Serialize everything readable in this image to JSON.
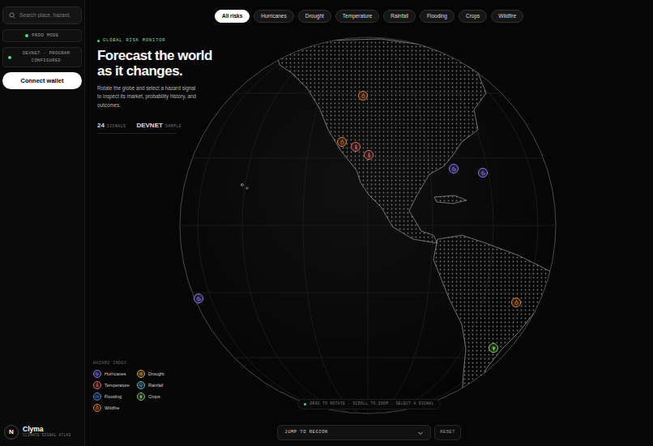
{
  "sidebar": {
    "search_placeholder": "Search place, hazard,",
    "mode_badge": "PROD MODE",
    "network_status": "DEVNET · PROGRAM CONFIGURED",
    "connect_button": "Connect wallet",
    "brand": {
      "logo": "N",
      "name": "Clyma",
      "tagline": "CLIMATE SIGNAL ATLAS"
    }
  },
  "filters": [
    {
      "label": "All risks",
      "selected": true
    },
    {
      "label": "Hurricanes",
      "selected": false
    },
    {
      "label": "Drought",
      "selected": false
    },
    {
      "label": "Temperature",
      "selected": false
    },
    {
      "label": "Rainfall",
      "selected": false
    },
    {
      "label": "Flooding",
      "selected": false
    },
    {
      "label": "Crops",
      "selected": false
    },
    {
      "label": "Wildfire",
      "selected": false
    }
  ],
  "hero": {
    "eyebrow": "GLOBAL RISK MONITOR",
    "title_lines": [
      "Forecast the world",
      "as it changes."
    ],
    "description": "Rotate the globe and select a hazard signal to inspect its market, probability history, and outcomes.",
    "signal_count": "24",
    "signal_label": "SIGNALS",
    "network": "DEVNET",
    "network_label": "SAMPLE"
  },
  "legend": {
    "title": "HAZARD INDEX",
    "items": [
      {
        "label": "Hurricanes",
        "kind": "hurricane",
        "color": "#8b7cf6"
      },
      {
        "label": "Drought",
        "kind": "drought",
        "color": "#d9a441"
      },
      {
        "label": "Temperature",
        "kind": "temperature",
        "color": "#e06a6a"
      },
      {
        "label": "Rainfall",
        "kind": "rainfall",
        "color": "#5fb3c9"
      },
      {
        "label": "Flooding",
        "kind": "flooding",
        "color": "#4a90d9"
      },
      {
        "label": "Crops",
        "kind": "crops",
        "color": "#7cc86a"
      },
      {
        "label": "Wildfire",
        "kind": "wildfire",
        "color": "#e0823c"
      }
    ]
  },
  "pins": [
    {
      "kind": "wildfire",
      "color": "#e0823c"
    },
    {
      "kind": "wildfire",
      "color": "#e0823c"
    },
    {
      "kind": "temperature",
      "color": "#e06a6a"
    },
    {
      "kind": "temperature",
      "color": "#e06a6a"
    },
    {
      "kind": "hurricane",
      "color": "#8b7cf6"
    },
    {
      "kind": "hurricane",
      "color": "#8b7cf6"
    },
    {
      "kind": "hurricane",
      "color": "#8b7cf6"
    },
    {
      "kind": "wildfire",
      "color": "#e0823c"
    },
    {
      "kind": "crops",
      "color": "#7cc86a"
    }
  ],
  "hint": "DRAG TO ROTATE · SCROLL TO ZOOM · SELECT A SIGNAL",
  "region_select": {
    "label": "JUMP TO REGION"
  },
  "reset": "RESET"
}
